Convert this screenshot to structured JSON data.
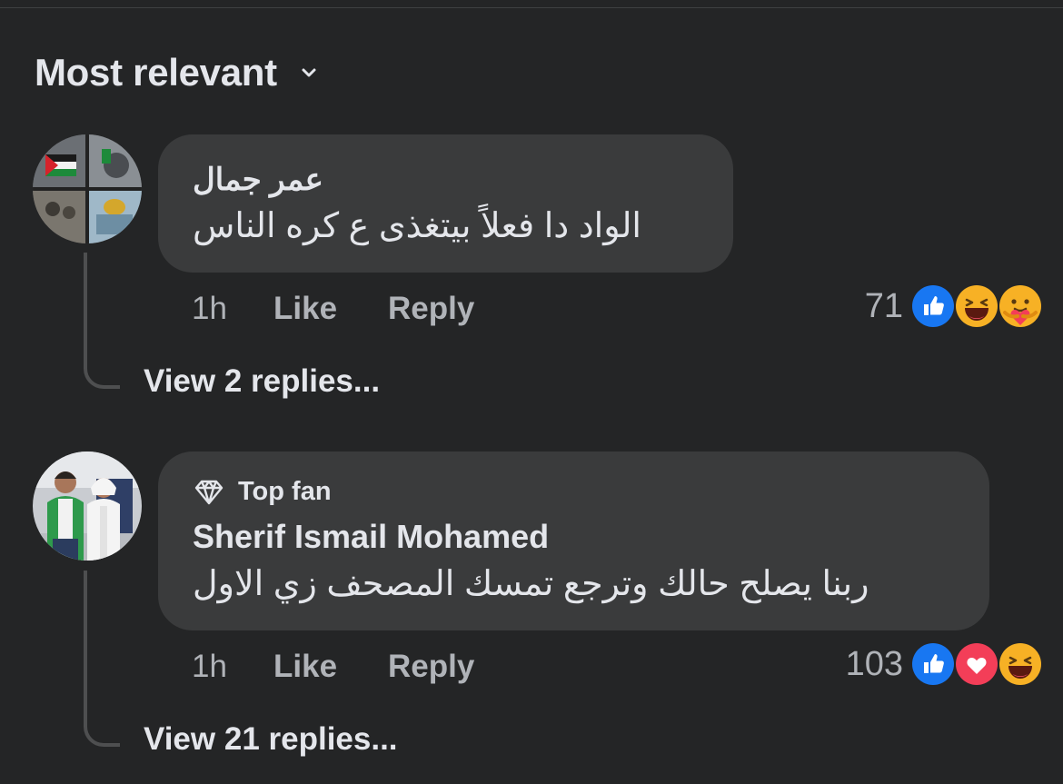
{
  "sort": {
    "label": "Most relevant"
  },
  "comments": [
    {
      "author": "عمر جمال",
      "text": "الواد دا فعلاً بيتغذى ع كره الناس",
      "time": "1h",
      "like_label": "Like",
      "reply_label": "Reply",
      "reaction_count": "71",
      "reactions": [
        "like-icon",
        "haha-icon",
        "care-icon"
      ],
      "view_replies": "View 2 replies..."
    },
    {
      "badge": "Top fan",
      "author": "Sherif Ismail Mohamed",
      "text": "ربنا يصلح حالك وترجع تمسك المصحف زي الاول",
      "time": "1h",
      "like_label": "Like",
      "reply_label": "Reply",
      "reaction_count": "103",
      "reactions": [
        "like-icon",
        "love-icon",
        "haha-icon"
      ],
      "view_replies": "View 21 replies..."
    }
  ],
  "colors": {
    "background": "#242526",
    "bubble": "#3a3b3c",
    "like": "#1877f2",
    "love": "#f33e58",
    "haha": "#f7b125"
  }
}
